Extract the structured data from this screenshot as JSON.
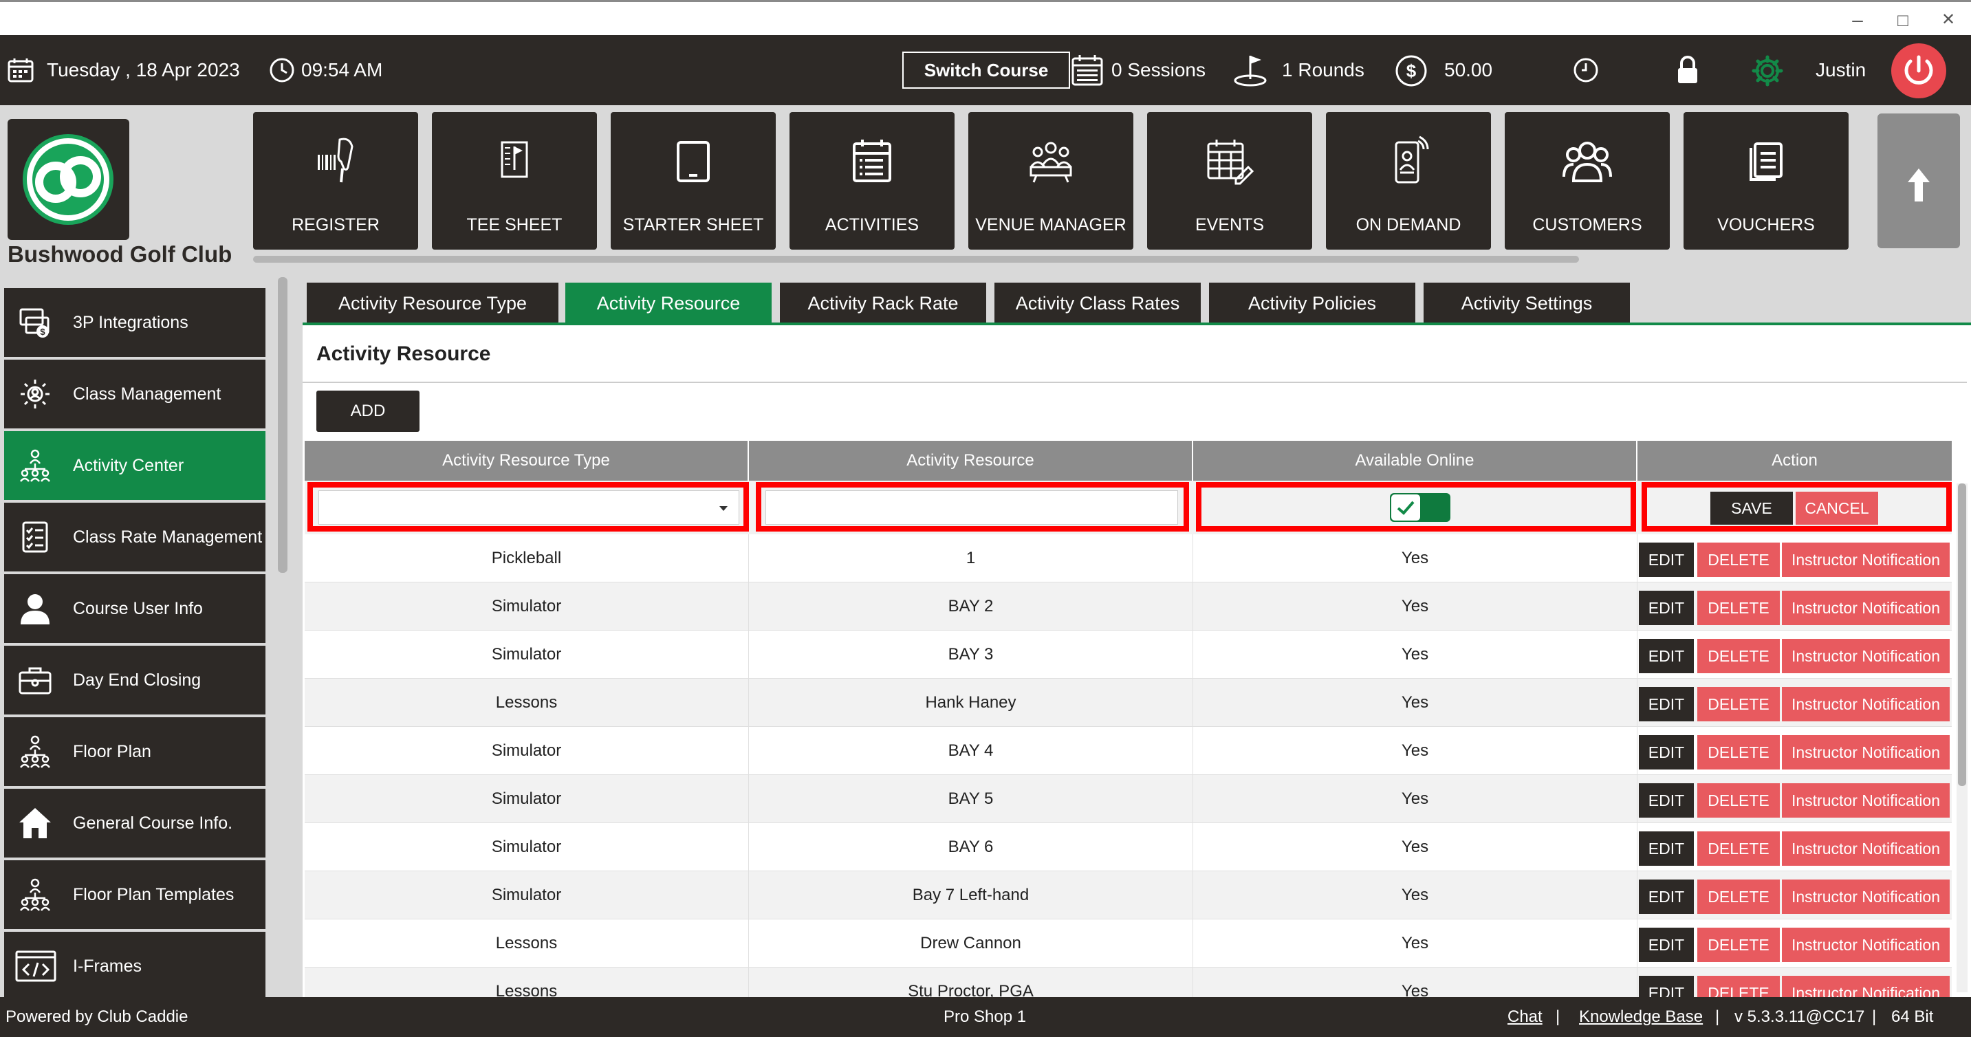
{
  "window": {
    "controls": {
      "minimize": "–",
      "maximize": "□",
      "close": "✕"
    }
  },
  "header": {
    "date_label": "Tuesday ,  18 Apr 2023",
    "time_label": "09:54 AM",
    "switch_course_label": "Switch Course",
    "sessions_label": "0 Sessions",
    "rounds_label": "1 Rounds",
    "balance_label": "50.00",
    "user_name": "Justin"
  },
  "brand": {
    "club_name": "Bushwood Golf Club",
    "accent_color": "#128a48",
    "dark_color": "#2d2926",
    "danger_color": "#e85a5f"
  },
  "nav_tiles": [
    {
      "label": "REGISTER",
      "icon": "barcode-scanner-icon"
    },
    {
      "label": "TEE SHEET",
      "icon": "tee-sheet-icon"
    },
    {
      "label": "STARTER SHEET",
      "icon": "tablet-icon"
    },
    {
      "label": "ACTIVITIES",
      "icon": "calendar-list-icon"
    },
    {
      "label": "VENUE MANAGER",
      "icon": "venue-manager-icon"
    },
    {
      "label": "EVENTS",
      "icon": "events-calendar-icon"
    },
    {
      "label": "ON DEMAND",
      "icon": "phone-person-icon"
    },
    {
      "label": "CUSTOMERS",
      "icon": "customers-icon"
    },
    {
      "label": "VOUCHERS",
      "icon": "voucher-icon"
    }
  ],
  "sidebar": {
    "items": [
      {
        "label": "3P Integrations",
        "icon": "integrations-icon",
        "active": false
      },
      {
        "label": "Class Management",
        "icon": "class-management-icon",
        "active": false
      },
      {
        "label": "Activity  Center",
        "icon": "activity-center-icon",
        "active": true
      },
      {
        "label": "Class Rate Management",
        "icon": "checklist-icon",
        "active": false
      },
      {
        "label": "Course User Info",
        "icon": "user-icon",
        "active": false
      },
      {
        "label": "Day End Closing",
        "icon": "briefcase-icon",
        "active": false
      },
      {
        "label": "Floor Plan",
        "icon": "floor-plan-icon",
        "active": false
      },
      {
        "label": "General Course Info.",
        "icon": "home-icon",
        "active": false
      },
      {
        "label": "Floor Plan Templates",
        "icon": "floor-plan-templates-icon",
        "active": false
      },
      {
        "label": "I-Frames",
        "icon": "code-icon",
        "active": false
      }
    ]
  },
  "tabs": [
    {
      "label": "Activity Resource Type",
      "active": false
    },
    {
      "label": "Activity Resource",
      "active": true
    },
    {
      "label": "Activity Rack Rate",
      "active": false
    },
    {
      "label": "Activity Class Rates",
      "active": false
    },
    {
      "label": "Activity Policies",
      "active": false
    },
    {
      "label": "Activity Settings",
      "active": false
    }
  ],
  "panel": {
    "title": "Activity Resource",
    "add_label": "ADD"
  },
  "grid": {
    "columns": [
      "Activity Resource Type",
      "Activity Resource",
      "Available Online",
      "Action"
    ],
    "edit_row": {
      "type_value": "",
      "resource_value": "",
      "available_online": true,
      "save_label": "SAVE",
      "cancel_label": "CANCEL"
    },
    "action_labels": {
      "edit": "EDIT",
      "delete": "DELETE",
      "notify": "Instructor Notification"
    },
    "rows": [
      {
        "type": "Pickleball",
        "resource": "1",
        "online": "Yes"
      },
      {
        "type": "Simulator",
        "resource": "BAY 2",
        "online": "Yes"
      },
      {
        "type": "Simulator",
        "resource": "BAY 3",
        "online": "Yes"
      },
      {
        "type": "Lessons",
        "resource": "Hank Haney",
        "online": "Yes"
      },
      {
        "type": "Simulator",
        "resource": "BAY 4",
        "online": "Yes"
      },
      {
        "type": "Simulator",
        "resource": "BAY 5",
        "online": "Yes"
      },
      {
        "type": "Simulator",
        "resource": "BAY 6",
        "online": "Yes"
      },
      {
        "type": "Simulator",
        "resource": "Bay 7 Left-hand",
        "online": "Yes"
      },
      {
        "type": "Lessons",
        "resource": "Drew Cannon",
        "online": "Yes"
      },
      {
        "type": "Lessons",
        "resource": "Stu Proctor, PGA",
        "online": "Yes"
      }
    ]
  },
  "footer": {
    "powered_by": "Powered by Club Caddie",
    "location": "Pro Shop 1",
    "chat_label": "Chat",
    "separator": "|",
    "kb_label": "Knowledge Base",
    "version": "v 5.3.3.11@CC17",
    "bitness": "64 Bit"
  }
}
